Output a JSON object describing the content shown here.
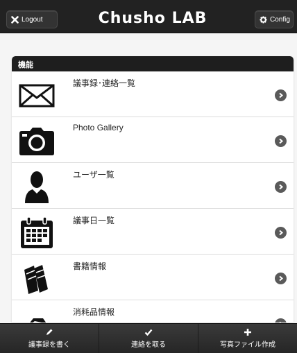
{
  "header": {
    "title": "Chusho LAB",
    "logout_label": "Logout",
    "config_label": "Config"
  },
  "menu": {
    "divider": "機能",
    "items": [
      {
        "label": "議事録･連絡一覧",
        "icon": "envelope-icon"
      },
      {
        "label": "Photo Gallery",
        "icon": "camera-icon"
      },
      {
        "label": "ユーザ一覧",
        "icon": "user-icon"
      },
      {
        "label": "議事日一覧",
        "icon": "calendar-icon"
      },
      {
        "label": "書籍情報",
        "icon": "books-icon"
      },
      {
        "label": "消耗品情報",
        "icon": "consumables-icon"
      }
    ]
  },
  "footer": {
    "write_minutes": "議事録を書く",
    "contact": "連絡を取る",
    "create_photo_file": "写真ファイル作成"
  }
}
